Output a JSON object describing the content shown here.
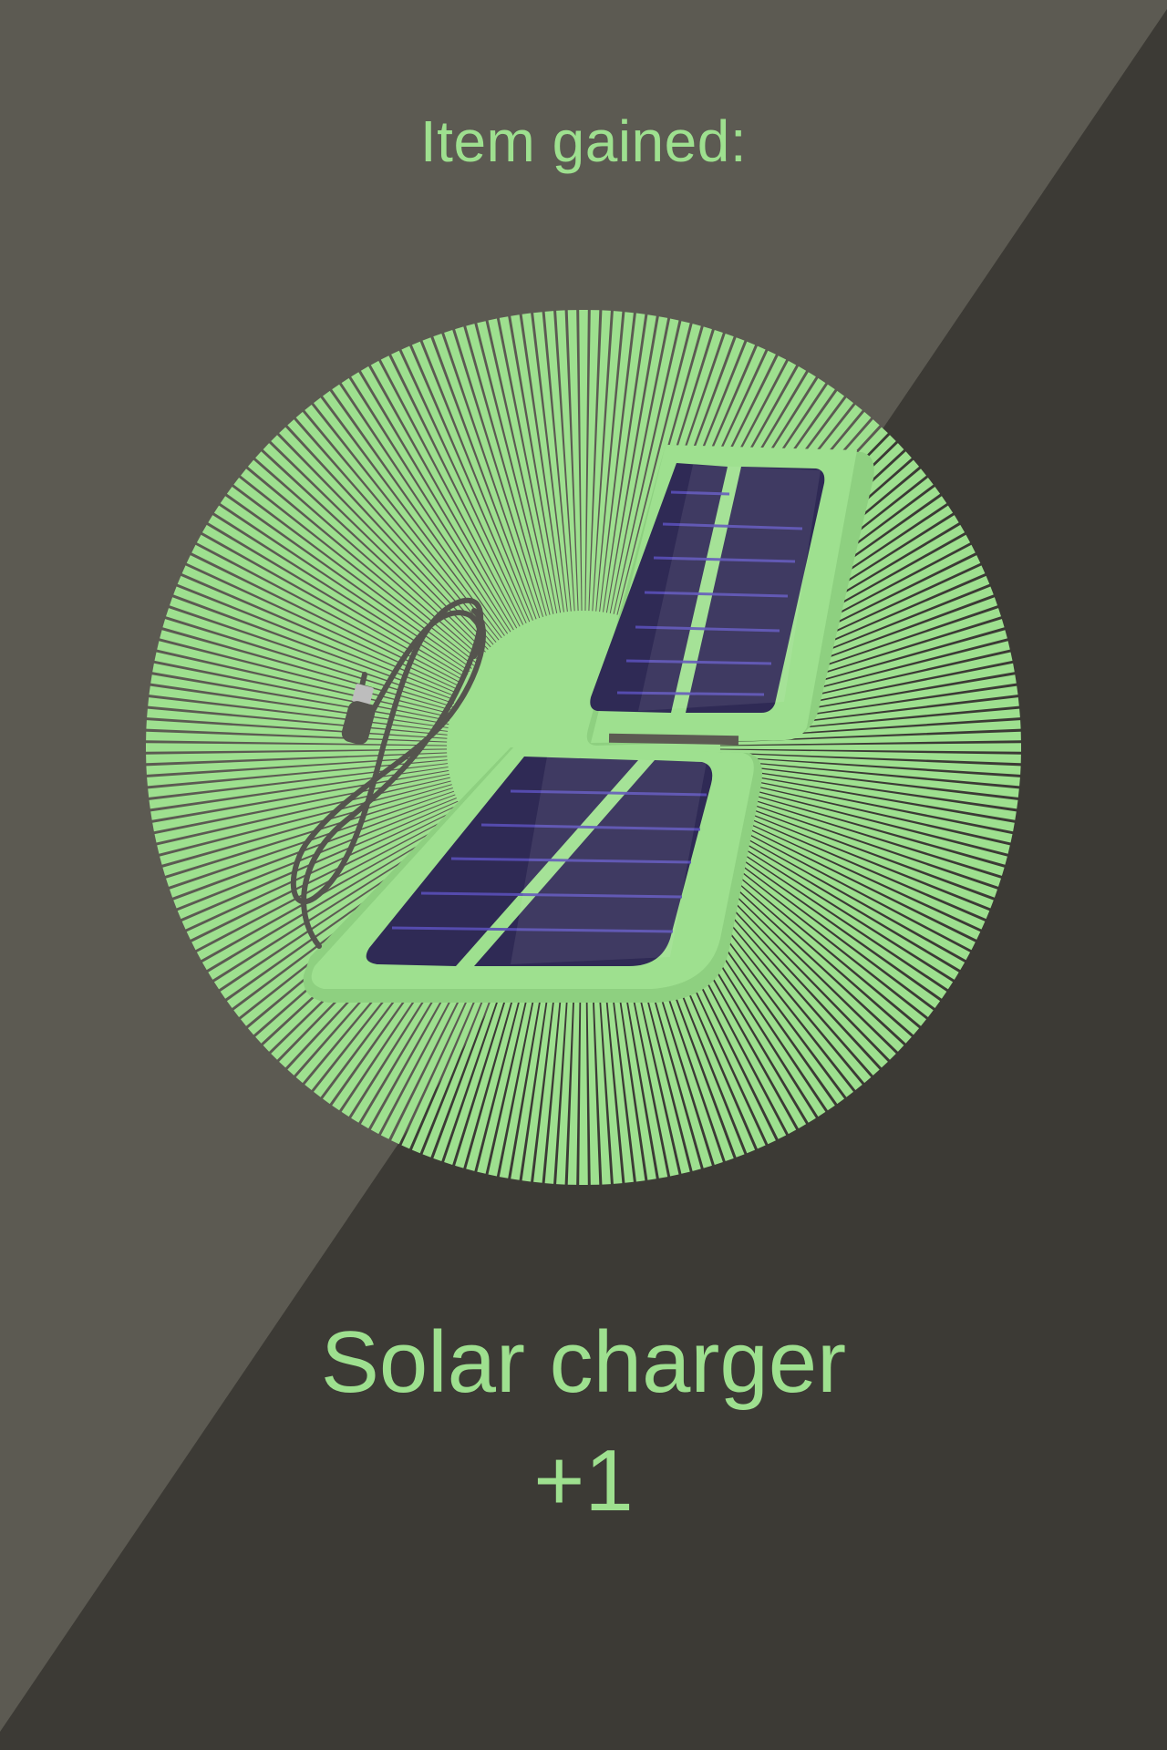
{
  "reward": {
    "heading": "Item gained:",
    "item_name": "Solar charger",
    "quantity": "+1",
    "icon": "solar-charger-icon"
  },
  "colors": {
    "background_light": "#5c5a52",
    "background_dark": "#3c3a35",
    "accent_green": "#9ee08f",
    "panel_dark": "#2f2a55",
    "panel_line": "#5a4fb8",
    "cable": "#55544e"
  }
}
